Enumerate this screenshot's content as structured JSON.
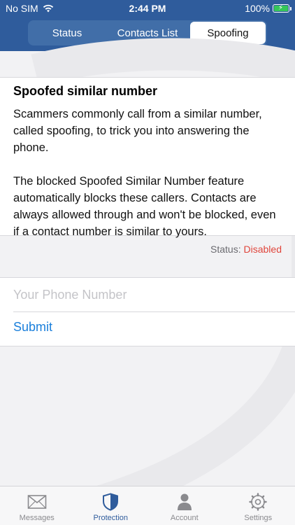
{
  "status_bar": {
    "carrier": "No SIM",
    "time": "2:44 PM",
    "battery": "100%"
  },
  "segments": [
    {
      "label": "Status",
      "active": false
    },
    {
      "label": "Contacts List",
      "active": false
    },
    {
      "label": "Spoofing",
      "active": true
    }
  ],
  "info": {
    "title": "Spoofed similar number",
    "paragraph1": "Scammers commonly call from a similar number, called spoofing, to trick you into answering the phone.",
    "paragraph2": "The blocked Spoofed Similar Number feature automatically blocks these callers. Contacts are always allowed through and won't be blocked, even if a contact number is similar to yours."
  },
  "status": {
    "label": "Status:",
    "value": "Disabled",
    "value_color": "#e0453b"
  },
  "form": {
    "phone_placeholder": "Your Phone Number",
    "phone_value": "",
    "submit_label": "Submit"
  },
  "tabbar": [
    {
      "label": "Messages",
      "icon": "envelope-icon",
      "active": false
    },
    {
      "label": "Protection",
      "icon": "shield-icon",
      "active": true
    },
    {
      "label": "Account",
      "icon": "person-icon",
      "active": false
    },
    {
      "label": "Settings",
      "icon": "gear-icon",
      "active": false
    }
  ],
  "colors": {
    "header": "#2f5c9c",
    "accent": "#1a7fdb"
  }
}
